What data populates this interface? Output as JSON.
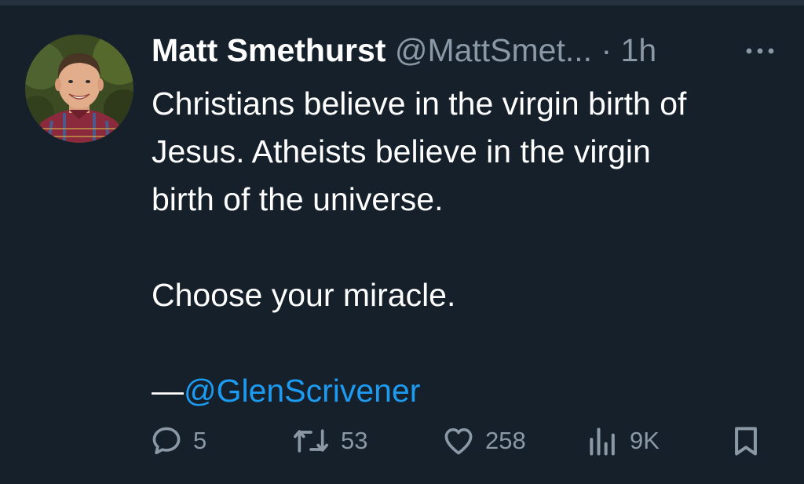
{
  "tweet": {
    "author_name": "Matt Smethurst",
    "author_handle": "@MattSmet...",
    "separator": "·",
    "time": "1h",
    "lines": [
      "Christians believe in the virgin birth of",
      "Jesus. Atheists believe in the virgin",
      "birth of the universe."
    ],
    "line2": "Choose your miracle.",
    "credit_dash": "—",
    "credit_mention": "@GlenScrivener"
  },
  "actions": {
    "reply_count": "5",
    "retweet_count": "53",
    "like_count": "258",
    "views_count": "9K"
  },
  "icons": {
    "more": "more-horizontal-icon",
    "reply": "speech-bubble-icon",
    "retweet": "retweet-arrows-icon",
    "like": "heart-icon",
    "views": "bar-chart-icon",
    "bookmark": "bookmark-icon"
  },
  "colors": {
    "background": "#15202b",
    "text": "#ffffff",
    "muted": "#8b98a5",
    "link": "#1d9bf0"
  }
}
